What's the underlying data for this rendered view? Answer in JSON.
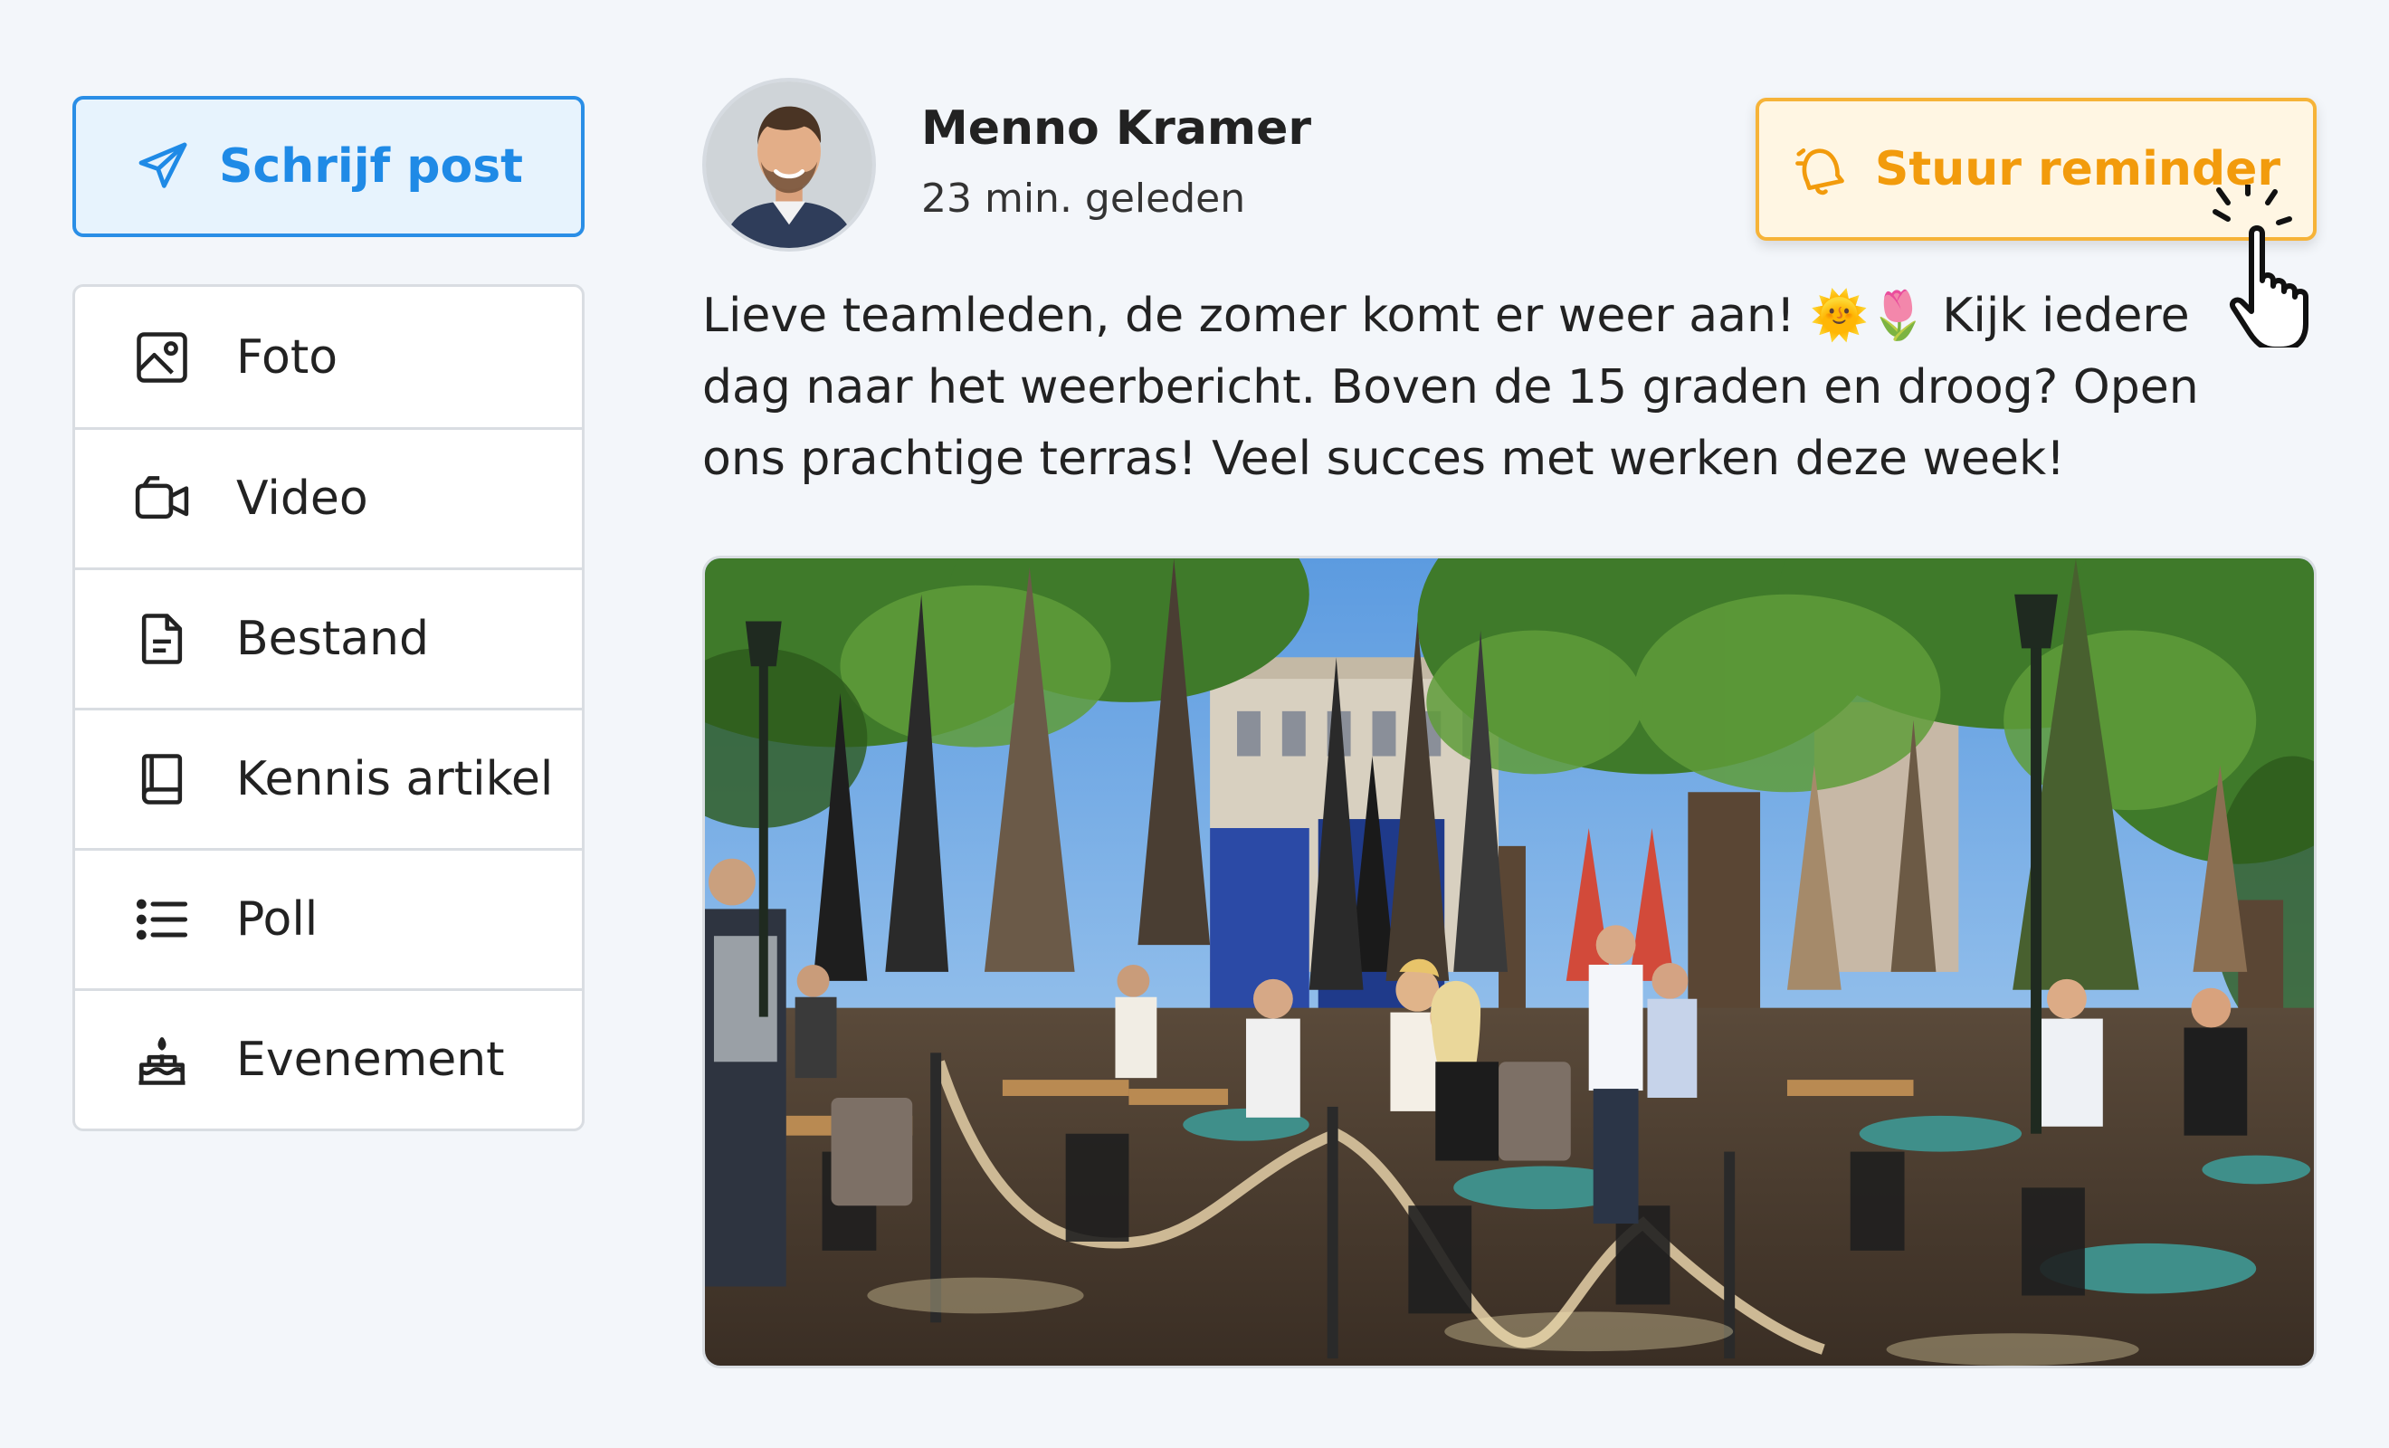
{
  "composer": {
    "write_post_label": "Schrijf post",
    "items": [
      {
        "label": "Foto",
        "icon": "image-icon"
      },
      {
        "label": "Video",
        "icon": "video-camera-icon"
      },
      {
        "label": "Bestand",
        "icon": "file-icon"
      },
      {
        "label": "Kennis artikel",
        "icon": "book-icon"
      },
      {
        "label": "Poll",
        "icon": "list-icon"
      },
      {
        "label": "Evenement",
        "icon": "cake-icon"
      }
    ]
  },
  "post": {
    "author": "Menno Kramer",
    "timestamp": "23 min. geleden",
    "reminder_label": "Stuur reminder",
    "text": "Lieve teamleden, de zomer komt er weer aan! 🌞🌷 Kijk iedere dag naar het weerbericht. Boven de 15 graden en droog? Open ons prachtige terras! Veel succes met werken deze week!"
  },
  "colors": {
    "accent_blue": "#2a8ee6",
    "accent_orange": "#f29b0c",
    "background": "#f3f6fa"
  }
}
